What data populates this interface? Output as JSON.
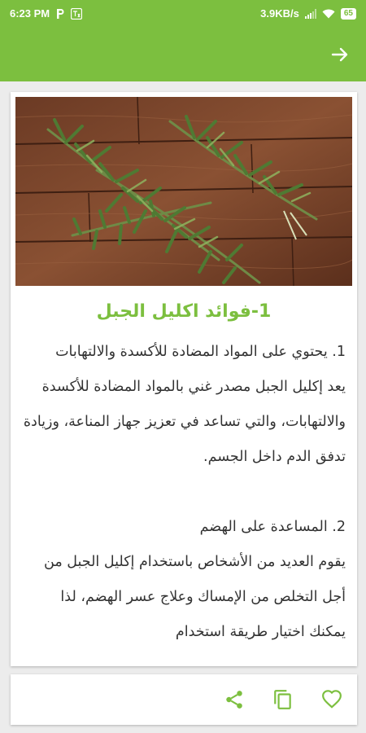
{
  "status_bar": {
    "time": "6:23 PM",
    "speed": "3.9KB/s",
    "battery": "65",
    "left_icons": [
      "parking-notification-icon",
      "translate-notification-icon"
    ],
    "right_icons": [
      "signal-icon",
      "wifi-icon",
      "battery-icon"
    ]
  },
  "app_bar": {
    "back_icon": "arrow-right-icon"
  },
  "colors": {
    "accent": "#7cbf3f",
    "body_text": "#333333",
    "background": "#ececec"
  },
  "article": {
    "image": "rosemary-sprigs-on-wood-photo",
    "title": "1-فوائد اكليل الجبل",
    "paragraphs": [
      "1. يحتوي على المواد المضادة للأكسدة والالتهابات",
      "يعد إكليل الجبل مصدر غني بالمواد المضادة للأكسدة والالتهابات، والتي تساعد في تعزيز جهاز المناعة، وزيادة تدفق الدم داخل الجسم.",
      "",
      "2. المساعدة على الهضم",
      "يقوم العديد من الأشخاص باستخدام إكليل الجبل من أجل التخلص من الإمساك وعلاج عسر الهضم، لذا يمكنك اختيار طريقة استخدام"
    ]
  },
  "bottom_actions": {
    "icons": [
      "share-icon",
      "copy-icon",
      "favorite-heart-icon"
    ]
  }
}
